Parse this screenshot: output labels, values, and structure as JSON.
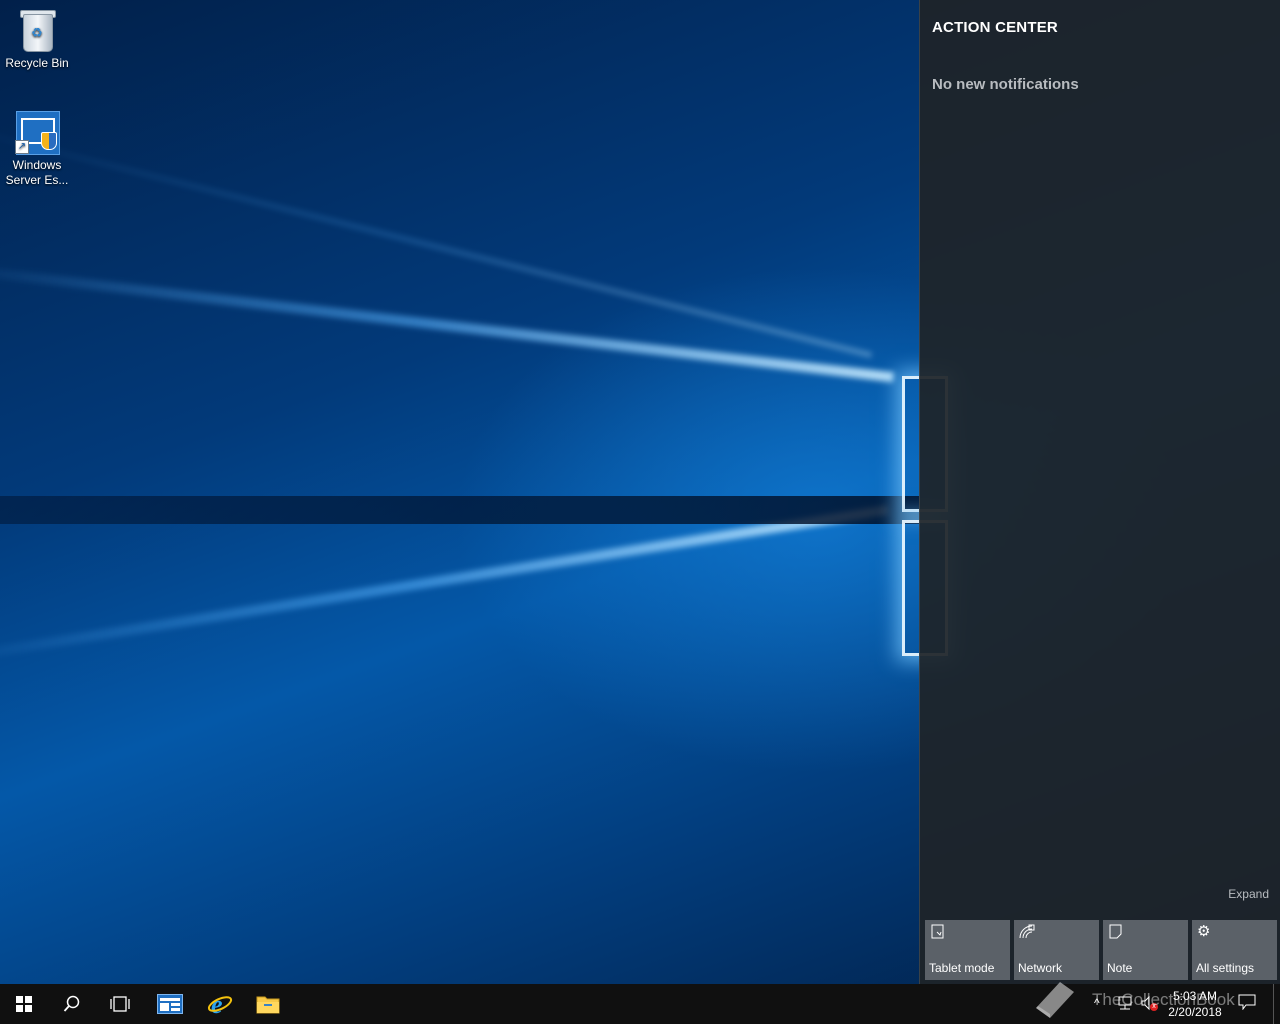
{
  "desktop": {
    "icons": [
      {
        "label": "Recycle Bin",
        "icon": "recycle-bin-icon"
      },
      {
        "label": "Windows Server Es...",
        "icon": "windows-server-essentials-icon"
      }
    ]
  },
  "action_center": {
    "title": "ACTION CENTER",
    "empty_message": "No new notifications",
    "expand_label": "Expand",
    "quick_actions": [
      {
        "label": "Tablet mode",
        "icon": "tablet-mode-icon"
      },
      {
        "label": "Network",
        "icon": "network-icon"
      },
      {
        "label": "Note",
        "icon": "note-icon"
      },
      {
        "label": "All settings",
        "icon": "gear-icon"
      }
    ]
  },
  "taskbar": {
    "pinned": [
      "start",
      "search",
      "task-view",
      "windows-server-essentials",
      "internet-explorer",
      "file-explorer"
    ],
    "clock": {
      "time": "5:03 AM",
      "date": "2/20/2018"
    }
  },
  "watermark": {
    "text": "TheCollectionBook"
  },
  "colors": {
    "taskbar": "#101010",
    "action_center_bg": "#1e2428",
    "quick_action_tile": "#5b6168",
    "accent": "#0078d7"
  }
}
